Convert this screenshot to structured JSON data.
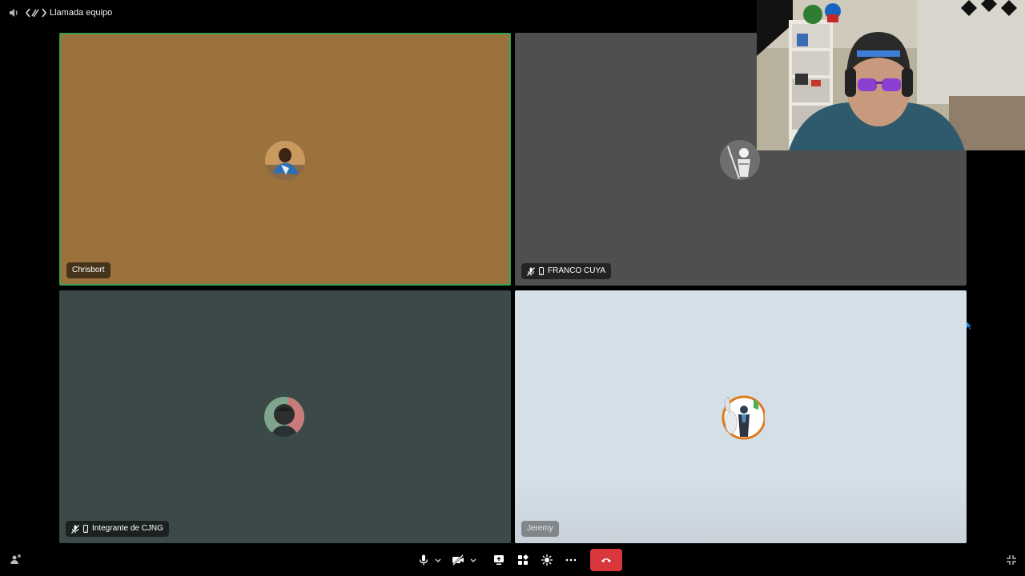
{
  "window": {
    "title": "Llamada equipo",
    "speaker_icon": "speaker-icon",
    "activity_icon": "code-brackets-icon"
  },
  "participants": [
    {
      "name": "Chrisbort",
      "speaking": true,
      "mic_muted": false,
      "mobile": false,
      "tile_color": "#9b713c",
      "avatar_icon": "user-avatar"
    },
    {
      "name": "FRANCO CUYA",
      "speaking": false,
      "mic_muted": true,
      "mobile": true,
      "tile_color": "#4f4f4f",
      "avatar_icon": "user-avatar"
    },
    {
      "name": "Integrante de CJNG",
      "speaking": false,
      "mic_muted": true,
      "mobile": true,
      "tile_color": "#3b4a48",
      "avatar_icon": "user-avatar"
    },
    {
      "name": "Jeremy",
      "speaking": false,
      "mic_muted": false,
      "mobile": false,
      "tile_color": "#d5dfe8",
      "avatar_icon": "user-avatar"
    }
  ],
  "self_camera": {
    "icon": "webcam-feed"
  },
  "controls": {
    "items": [
      "mic-icon",
      "chevron-down-icon",
      "camera-off-icon",
      "chevron-down-icon",
      "screen-share-icon",
      "activities-icon",
      "soundboard-icon",
      "more-icon",
      "end-call-icon"
    ],
    "end_call_color": "#da373c",
    "left_icon": "popout-user-icon",
    "right_icon": "exit-fullscreen-icon"
  }
}
